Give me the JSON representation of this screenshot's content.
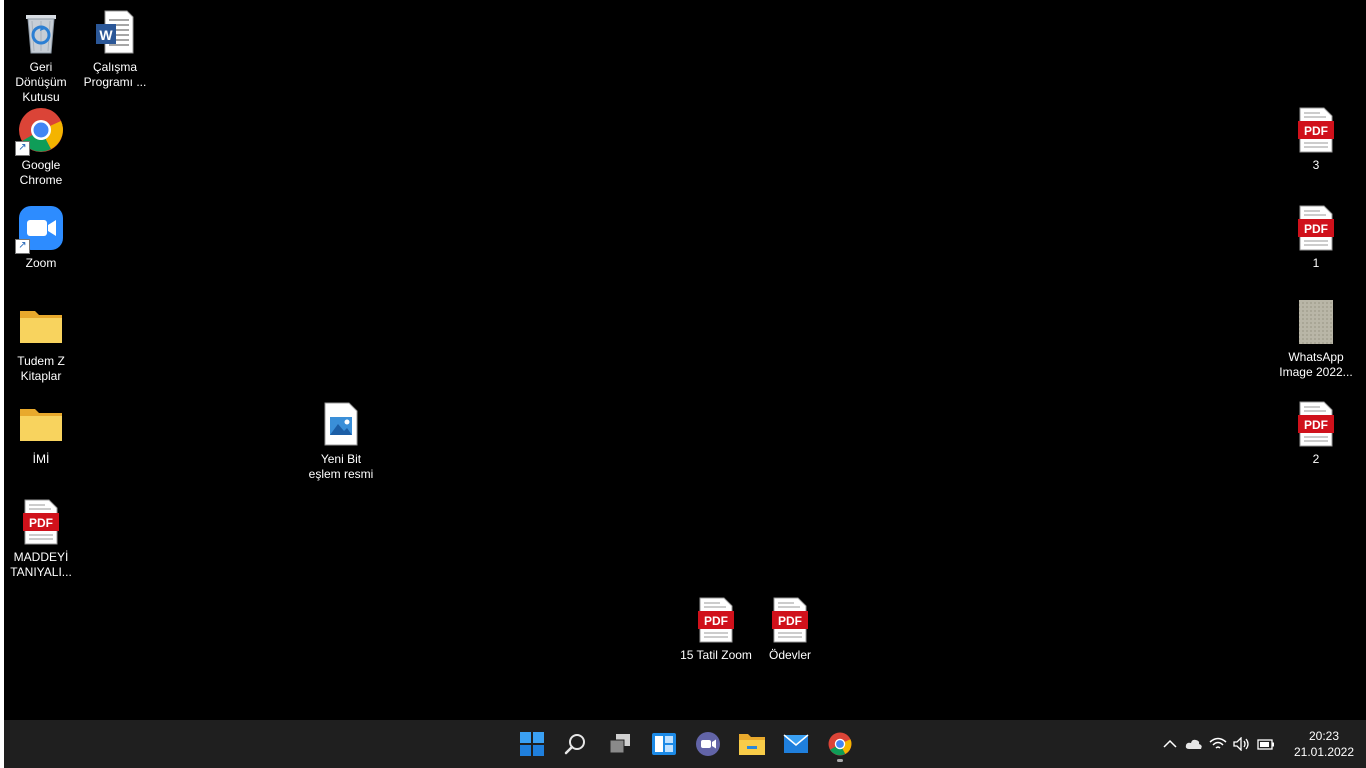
{
  "desktop": {
    "icons": {
      "recycle_bin": "Geri Dönüşüm Kutusu",
      "word_doc": "Çalışma Programı ...",
      "chrome": "Google Chrome",
      "zoom": "Zoom",
      "folder_tudem": "Tudem Z Kitaplar",
      "folder_imi": "İMİ",
      "pdf_maddeyi": "MADDEYİ TANIYALI...",
      "bitmap": "Yeni Bit eşlem resmi",
      "pdf_15tatil": "15 Tatil Zoom",
      "pdf_odevler": "Ödevler",
      "pdf_3": "3",
      "pdf_1": "1",
      "whatsapp_image": "WhatsApp Image 2022...",
      "pdf_2": "2"
    },
    "pdf_badge": "PDF"
  },
  "taskbar": {
    "apps": [
      "start-icon",
      "search-icon",
      "task-view-icon",
      "widgets-icon",
      "chat-icon",
      "file-explorer-icon",
      "mail-icon",
      "chrome-icon"
    ],
    "tray": [
      "chevron-up-icon",
      "onedrive-cloud-icon",
      "wifi-icon",
      "volume-icon",
      "battery-icon"
    ],
    "time": "20:23",
    "date": "21.01.2022"
  },
  "colors": {
    "pdf_red": "#d0111b",
    "folder_yellow": "#f6c343",
    "taskbar_bg": "#1f1f1f",
    "accent_blue": "#2b88d8"
  }
}
